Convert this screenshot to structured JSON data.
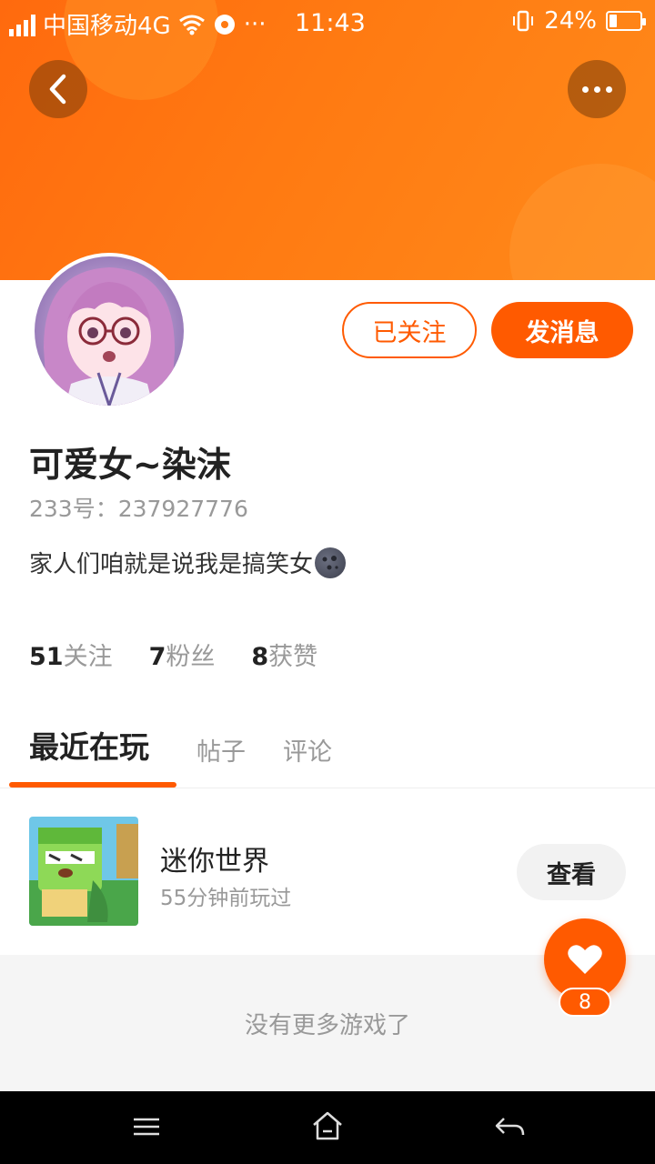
{
  "status_bar": {
    "carrier": "中国移动4G",
    "extra": "···",
    "time": "11:43",
    "battery": "24%",
    "battery_level": 0.24
  },
  "header": {
    "back_icon": "chevron-left-icon",
    "more_icon": "more-dots-icon"
  },
  "profile": {
    "name": "可爱女~染沫",
    "uid": "233号：237927776",
    "bio": "家人们咱就是说我是搞笑女",
    "bio_emoji": "new-moon-face-icon",
    "follow_label": "已关注",
    "message_label": "发消息"
  },
  "stats": [
    {
      "value": "51",
      "label": "关注"
    },
    {
      "value": "7",
      "label": "粉丝"
    },
    {
      "value": "8",
      "label": "获赞"
    }
  ],
  "tabs": [
    {
      "label": "最近在玩",
      "active": true
    },
    {
      "label": "帖子",
      "active": false
    },
    {
      "label": "评论",
      "active": false
    }
  ],
  "games": [
    {
      "name": "迷你世界",
      "time": "55分钟前玩过",
      "button": "查看"
    }
  ],
  "no_more": "没有更多游戏了",
  "fab": {
    "icon": "heart-icon",
    "count": "8"
  },
  "colors": {
    "accent": "#ff5a00",
    "banner": "#ff7a12"
  }
}
